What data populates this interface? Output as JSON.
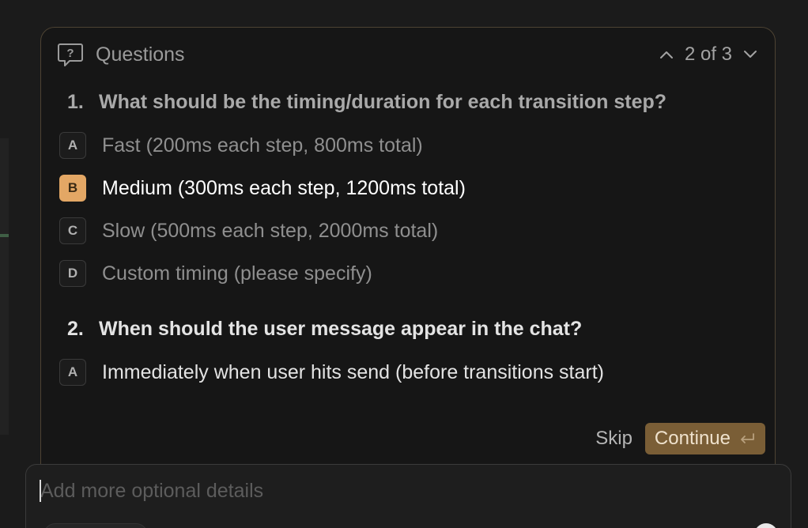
{
  "header": {
    "title": "Questions",
    "pager": "2 of 3"
  },
  "questions": [
    {
      "number": "1.",
      "title": "What should be the timing/duration for each transition step?",
      "options": [
        {
          "key": "A",
          "label": "Fast (200ms each step, 800ms total)",
          "selected": false
        },
        {
          "key": "B",
          "label": "Medium (300ms each step, 1200ms total)",
          "selected": true
        },
        {
          "key": "C",
          "label": "Slow (500ms each step, 2000ms total)",
          "selected": false
        },
        {
          "key": "D",
          "label": "Custom timing (please specify)",
          "selected": false
        }
      ]
    },
    {
      "number": "2.",
      "title": "When should the user message appear in the chat?",
      "options": [
        {
          "key": "A",
          "label": "Immediately when user hits send (before transitions start)",
          "selected": false
        }
      ]
    }
  ],
  "actions": {
    "skip_label": "Skip",
    "continue_label": "Continue"
  },
  "composer": {
    "placeholder": "Add more optional details",
    "value": ""
  },
  "colors": {
    "accent": "#e3a765",
    "continue_bg": "#7a5e36",
    "card_border": "#4d4333"
  },
  "icons": {
    "header": "question-bubble-icon",
    "prev": "chevron-up-icon",
    "next": "chevron-down-icon",
    "continue": "return-icon"
  }
}
